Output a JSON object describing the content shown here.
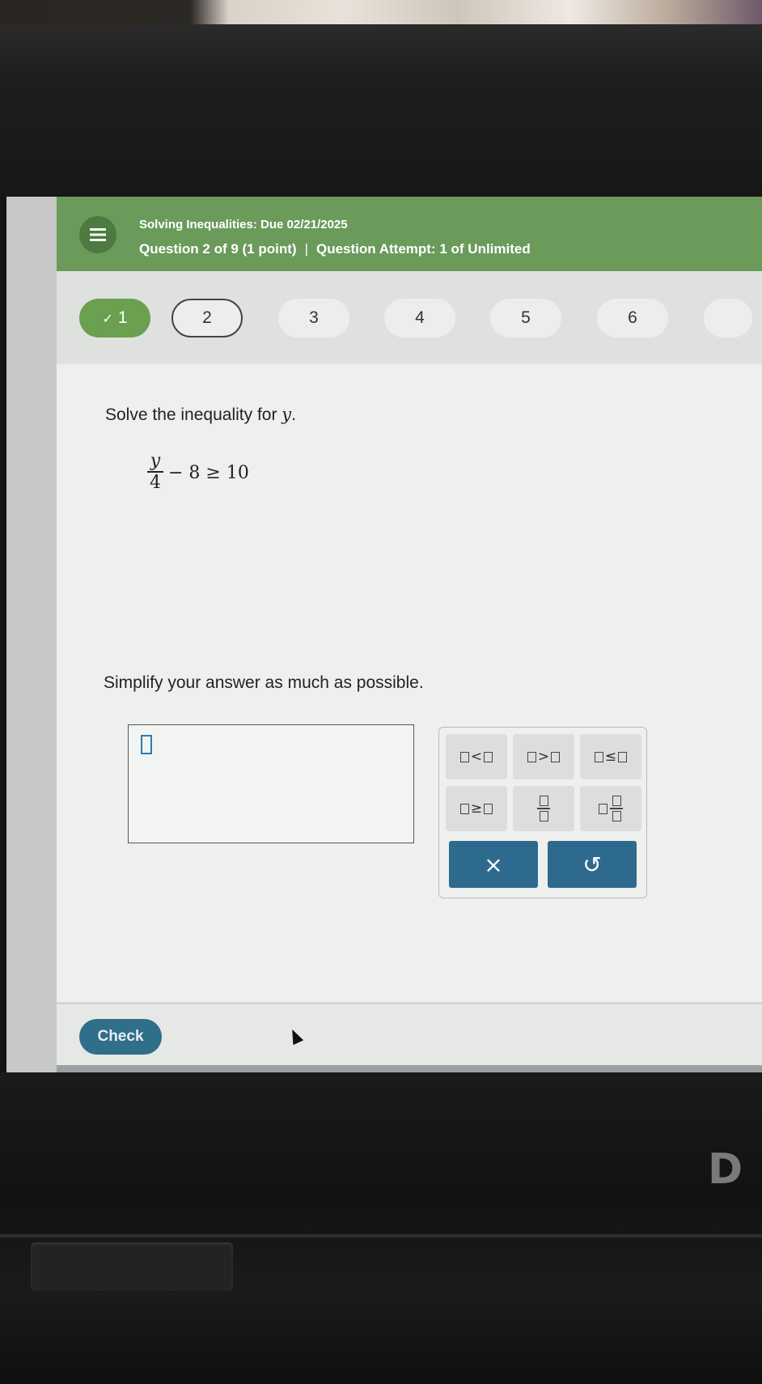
{
  "header": {
    "title": "Solving Inequalities: Due 02/21/2025",
    "question_info": "Question 2 of 9 (1 point)",
    "separator": "|",
    "attempt_info": "Question Attempt: 1 of Unlimited",
    "menu_icon": "hamburger-menu-icon"
  },
  "question_nav": {
    "items": [
      {
        "label": "1",
        "state": "completed",
        "check_mark": "✓"
      },
      {
        "label": "2",
        "state": "current"
      },
      {
        "label": "3",
        "state": "unvisited"
      },
      {
        "label": "4",
        "state": "unvisited"
      },
      {
        "label": "5",
        "state": "unvisited"
      },
      {
        "label": "6",
        "state": "unvisited"
      }
    ]
  },
  "problem": {
    "prompt_text": "Solve the inequality for ",
    "prompt_var": "y",
    "prompt_end": ".",
    "numerator": "y",
    "denominator": "4",
    "rest": "− 8 ≥ 10",
    "instruction": "Simplify your answer as much as possible."
  },
  "palette": {
    "less_than": "<",
    "greater_than": ">",
    "less_equal": "≤",
    "greater_equal": "≥",
    "clear_label": "×",
    "undo_label": "↺"
  },
  "footer": {
    "check_label": "Check"
  },
  "brand_mark": "D",
  "colors": {
    "header_green": "#6b9b5b",
    "completed_green": "#6aa04f",
    "action_blue": "#2e6a8e"
  }
}
